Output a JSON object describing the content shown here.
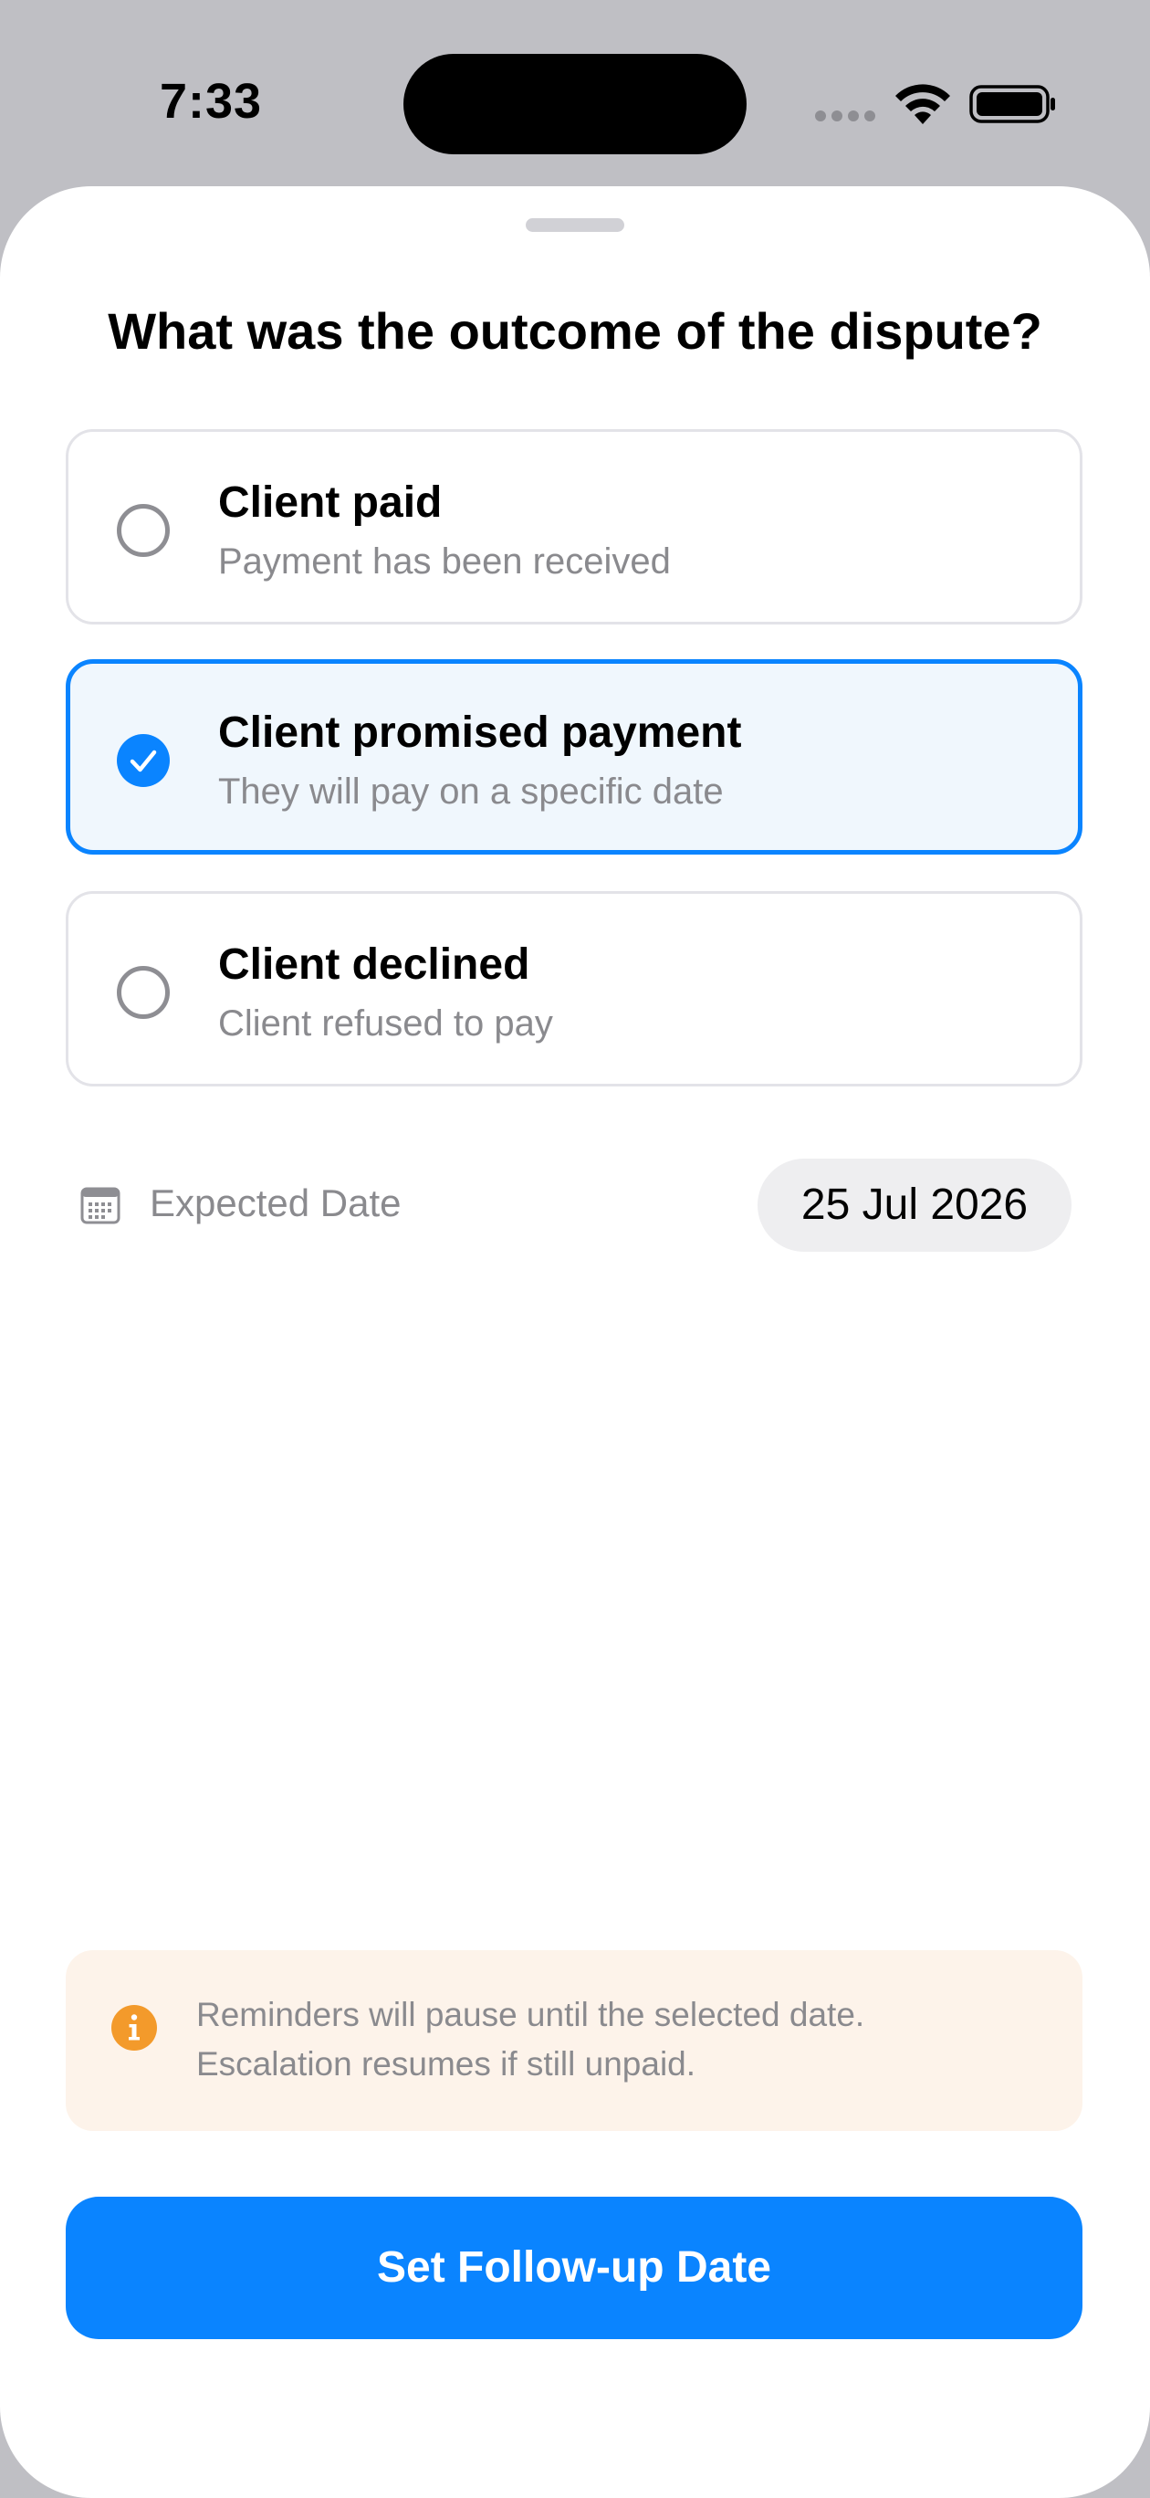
{
  "status_bar": {
    "time": "7:33"
  },
  "sheet": {
    "title": "What was the outcome of the dispute?",
    "options": [
      {
        "title": "Client paid",
        "subtitle": "Payment has been received",
        "selected": false
      },
      {
        "title": "Client promised payment",
        "subtitle": "They will pay on a specific date",
        "selected": true
      },
      {
        "title": "Client declined",
        "subtitle": "Client refused to pay",
        "selected": false
      }
    ],
    "date": {
      "label": "Expected Date",
      "value": "25 Jul 2026",
      "icon": "calendar-icon"
    },
    "info": {
      "line1": "Reminders will pause until the selected date.",
      "line2": "Escalation resumes if still unpaid.",
      "icon": "info-icon"
    },
    "button_label": "Set Follow-up Date"
  },
  "colors": {
    "accent": "#0A84FF",
    "selected_background": "#F0F7FD",
    "info_background": "#FDF3EA",
    "info_icon": "#F39A2B",
    "secondary_text": "#8A8A8E"
  }
}
